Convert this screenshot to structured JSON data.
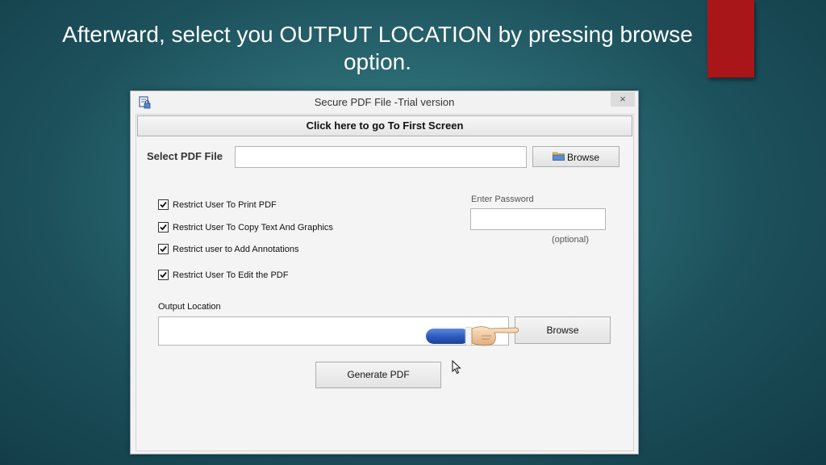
{
  "slide": {
    "title": "Afterward, select you OUTPUT LOCATION by pressing browse option.",
    "accent_color": "#a8161a"
  },
  "window": {
    "title": "Secure PDF File -Trial version",
    "close_label": "×",
    "app_icon": "pdf-lock-icon"
  },
  "form": {
    "first_screen_label": "Click here to go To First Screen",
    "select_pdf_label": "Select PDF File",
    "pdf_file_value": "",
    "browse_pdf_label": "Browse",
    "checkboxes": [
      {
        "label": "Restrict User To Print PDF",
        "checked": true
      },
      {
        "label": "Restrict User To Copy Text And Graphics",
        "checked": true
      },
      {
        "label": "Restrict user to Add Annotations",
        "checked": true
      },
      {
        "label": "Restrict User To Edit the PDF",
        "checked": true
      }
    ],
    "password_label": "Enter Password",
    "password_value": "",
    "optional_label": "(optional)",
    "output_location_label": "Output Location",
    "output_location_value": "",
    "browse_output_label": "Browse",
    "generate_label": "Generate PDF"
  },
  "overlay": {
    "pointer_hand": "pointing-hand-icon",
    "mouse_cursor": "mouse-cursor-icon"
  }
}
